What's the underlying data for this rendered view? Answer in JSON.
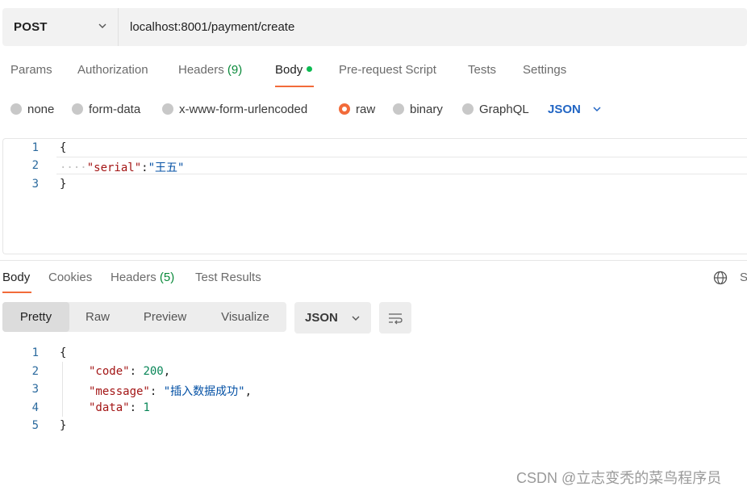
{
  "request": {
    "method": "POST",
    "url": "localhost:8001/payment/create"
  },
  "tabs": {
    "params": "Params",
    "authorization": "Authorization",
    "headers": "Headers",
    "headers_count": "(9)",
    "body": "Body",
    "prerequest": "Pre-request Script",
    "tests": "Tests",
    "settings": "Settings"
  },
  "body_types": {
    "none": "none",
    "form_data": "form-data",
    "urlencoded": "x-www-form-urlencoded",
    "raw": "raw",
    "binary": "binary",
    "graphql": "GraphQL",
    "selected": "raw",
    "format": "JSON"
  },
  "request_body": {
    "line_numbers": [
      "1",
      "2",
      "3"
    ],
    "open_brace": "{",
    "indent_dots": "····",
    "key": "\"serial\"",
    "colon": ":",
    "value": "\"王五\"",
    "close_brace": "}"
  },
  "response_tabs": {
    "body": "Body",
    "cookies": "Cookies",
    "headers": "Headers",
    "headers_count": "(5)",
    "test_results": "Test Results",
    "truncated_right": "S"
  },
  "view_modes": {
    "pretty": "Pretty",
    "raw": "Raw",
    "preview": "Preview",
    "visualize": "Visualize",
    "format": "JSON"
  },
  "response_body": {
    "line_numbers": [
      "1",
      "2",
      "3",
      "4",
      "5"
    ],
    "open_brace": "{",
    "close_brace": "}",
    "code_key": "\"code\"",
    "code_value": "200",
    "message_key": "\"message\"",
    "message_value": "\"插入数据成功\"",
    "data_key": "\"data\"",
    "data_value": "1"
  },
  "watermark": "CSDN @立志变秃的菜鸟程序员",
  "colors": {
    "accent": "#f26b3a",
    "success": "#0cbb52",
    "link_blue": "#2266c4"
  }
}
